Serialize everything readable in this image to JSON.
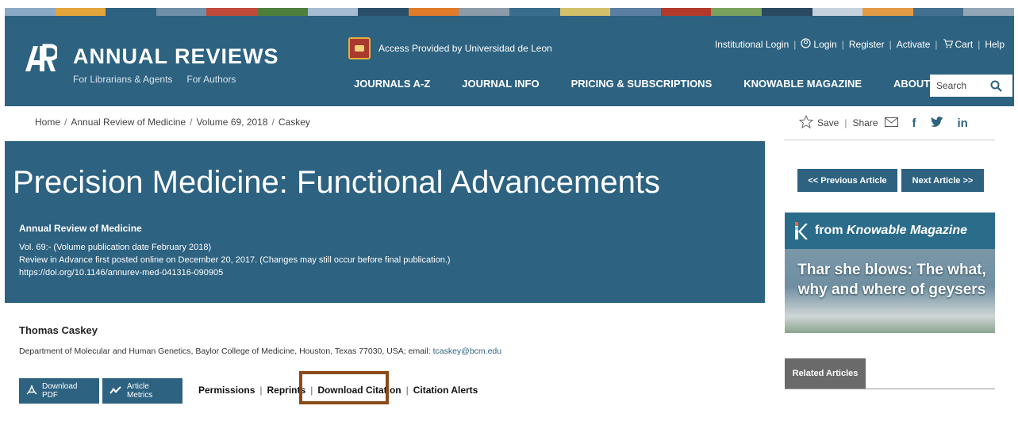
{
  "stripe_colors": [
    "#8aa9c4",
    "#e3a43a",
    "#2d6281",
    "#6f8fa8",
    "#c14a3a",
    "#4f7f3c",
    "#a5bcd2",
    "#2b4f6a",
    "#e07b2b",
    "#8c9ba8",
    "#396d8c",
    "#d3c06a",
    "#5a7fa0",
    "#b3392b",
    "#7aa05e",
    "#294a61",
    "#c6d3de",
    "#e39a45",
    "#44708f",
    "#93a6b7"
  ],
  "header": {
    "brand": "ANNUAL REVIEWS",
    "sub_links": [
      "For Librarians & Agents",
      "For Authors"
    ],
    "access": "Access Provided by Universidad de Leon",
    "top_links": {
      "institutional_login": "Institutional Login",
      "login": "Login",
      "register": "Register",
      "activate": "Activate",
      "cart": "Cart",
      "help": "Help"
    },
    "nav": [
      "JOURNALS A-Z",
      "JOURNAL INFO",
      "PRICING & SUBSCRIPTIONS",
      "KNOWABLE MAGAZINE",
      "ABOUT"
    ],
    "search_placeholder": "Search"
  },
  "breadcrumb": [
    "Home",
    "Annual Review of Medicine",
    "Volume 69, 2018",
    "Caskey"
  ],
  "share": {
    "save": "Save",
    "share": "Share",
    "facebook": "f",
    "linkedin": "in"
  },
  "article": {
    "title": "Precision Medicine: Functional Advancements",
    "journal": "Annual Review of Medicine",
    "volume_line": "Vol. 69:- (Volume publication date February 2018)",
    "advance_line": "Review in Advance first posted online on December 20, 2017. (Changes may still occur before final publication.)",
    "doi": "https://doi.org/10.1146/annurev-med-041316-090905"
  },
  "author": {
    "name": "Thomas Caskey",
    "affiliation": "Department of Molecular and Human Genetics, Baylor College of Medicine, Houston, Texas 77030, USA; email: ",
    "email": "tcaskey@bcm.edu"
  },
  "buttons": {
    "download_pdf": "Download PDF",
    "article_metrics": "Article Metrics",
    "prev_article": "<< Previous Article",
    "next_article": "Next Article >>"
  },
  "actions": [
    "Permissions",
    "Reprints",
    "Download Citation",
    "Citation Alerts"
  ],
  "ad": {
    "from": "from ",
    "magazine": "Knowable Magazine",
    "headline": "Thar she blows: The what, why and where of geysers"
  },
  "related": "Related Articles",
  "colors": {
    "brand_blue": "#2d6281",
    "highlight": "#8b4a17"
  }
}
